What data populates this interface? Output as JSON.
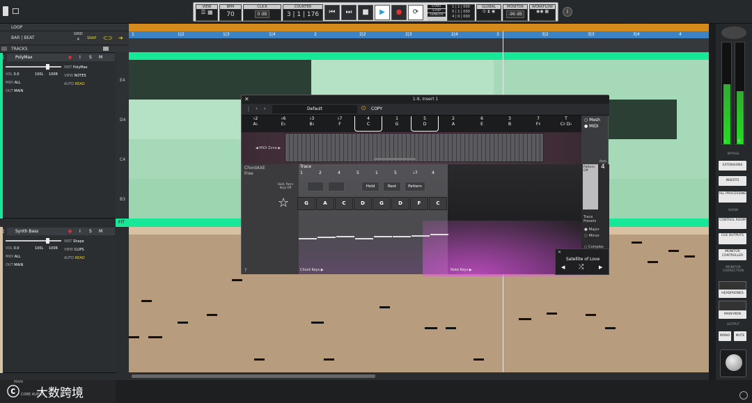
{
  "transport": {
    "view_label": "VIEW",
    "bpm_label": "BPM",
    "bpm_value": "70",
    "click_label": "CLICK",
    "click_value": "0 dB",
    "counter_label": "COUNTER",
    "counter_value": "3 | 1 | 176",
    "start_label": "START",
    "stop_label": "STOP",
    "length_label": "LENGTH",
    "start_value": "1 | 1 | 000",
    "stop_value": "5 | 1 | 000",
    "length_value": "4 | 0 | 000",
    "global_label": "GLOBAL",
    "monitor_label": "MONITOR",
    "monitor_value": "-96 dB",
    "workflow_label": "WORKFLOW"
  },
  "left": {
    "loop_label": "LOOP",
    "bar_beat_label": "BAR | BEAT",
    "grid_label": "GRID",
    "grid_value": "4",
    "snap_label": "SNAP",
    "tracks_label": "TRACKS"
  },
  "tracks": [
    {
      "name": "PolyMax",
      "vol": "0.0",
      "pan_l": "100L",
      "pan_r": "100R",
      "midi": "ALL",
      "out": "MAIN",
      "inst": "PolyMax",
      "view": "NOTES",
      "auto": "READ",
      "color": "#16e898"
    },
    {
      "name": "Synth Bass",
      "vol": "0.0",
      "pan_l": "100L",
      "pan_r": "100R",
      "midi": "ALL",
      "out": "MAIN",
      "inst": "Shape",
      "view": "CLIPS",
      "auto": "READ",
      "color": "#d8c0a3"
    }
  ],
  "track_field_labels": {
    "vol": "VOL",
    "midi": "MIDI",
    "out": "OUT",
    "inst": "INST",
    "view": "VIEW",
    "auto": "AUTO",
    "i": "I",
    "s": "S",
    "m": "M"
  },
  "ruler": [
    "1",
    "1|2",
    "1|3",
    "1|4",
    "2",
    "2|2",
    "2|3",
    "2|4",
    "3",
    "3|2",
    "3|3",
    "3|4",
    "4"
  ],
  "piano_labels": [
    "E4",
    "D4",
    "C4",
    "B3"
  ],
  "fit_label": "FIT",
  "right": {
    "bypass_label": "BYPASS",
    "buttons_bypass": [
      "EXTENSIONS",
      "INSERTS",
      "ALL PROCESSING"
    ],
    "show_label": "SHOW",
    "buttons_show": [
      "CONTROL ROOM",
      "CUE OUTPUTS",
      "MONITOR CONTROLLER"
    ],
    "monitor_correction_label": "MONITOR CORRECTION",
    "headphones_label": "HEADPHONES",
    "main_mon_label": "MAIN MON",
    "output_label": "OUTPUT",
    "mono_label": "MONO",
    "mute_label": "MUTE",
    "meter_l": "L",
    "meter_r": "R"
  },
  "plugin": {
    "window_title": "1-9, Insert 1",
    "preset_name": "Default",
    "copy_label": "COPY",
    "chords": [
      {
        "top": "♭2",
        "bottom": "A♭"
      },
      {
        "top": "♭6",
        "bottom": "E♭"
      },
      {
        "top": "♭3",
        "bottom": "B♭"
      },
      {
        "top": "♭7",
        "bottom": "F"
      },
      {
        "top": "4",
        "bottom": "C"
      },
      {
        "top": "1",
        "bottom": "G"
      },
      {
        "top": "5",
        "bottom": "D"
      },
      {
        "top": "2",
        "bottom": "A"
      },
      {
        "top": "6",
        "bottom": "E"
      },
      {
        "top": "3",
        "bottom": "B"
      },
      {
        "top": "7",
        "bottom": "F♯"
      },
      {
        "top": "T",
        "bottom": "C♯ D♭"
      }
    ],
    "mesh_label": "Mesh",
    "midi_label": "MIDI",
    "midi_zone_label": "MIDI Zone",
    "app_name": "ChordAXE",
    "app_edition": "Free",
    "trace_label": "Trace",
    "trace_numbers": [
      "1",
      "2",
      "4",
      "5",
      "1",
      "5",
      "♭7",
      "4"
    ],
    "hold_patrn_label": "Hold, Patrn Keys Off",
    "buttons": [
      "Hold",
      "Rest",
      "Pattern"
    ],
    "keys": [
      "G",
      "A",
      "C",
      "D",
      "G",
      "D",
      "F",
      "C"
    ],
    "pattern_off_label": "Pattern Off",
    "parts_label": "Parts",
    "parts_value": "4",
    "trace_presets_label": "Trace Presets",
    "major_label": "Major",
    "minor_label": "Minor",
    "complex_label": "Complex",
    "chord_keys_label": "Chord Keys",
    "note_keys_label": "Note Keys",
    "help_label": "?",
    "song_name": "Satellite of Love"
  },
  "bottom": {
    "main_label": "MAIN",
    "watermark": "大数跨境",
    "core_label": "CORE AUDIO"
  }
}
